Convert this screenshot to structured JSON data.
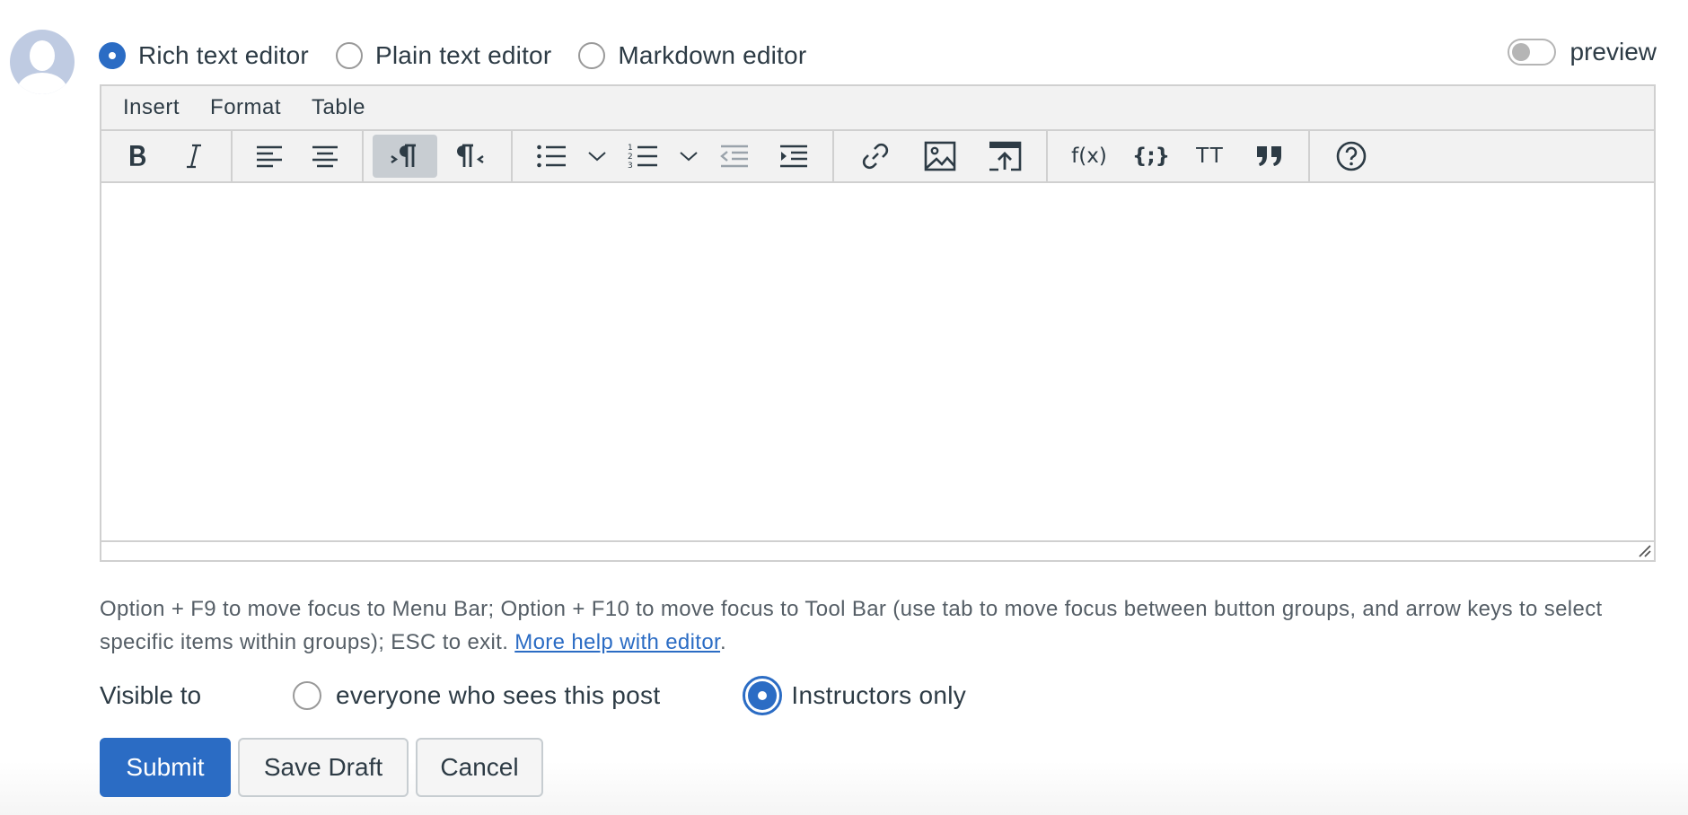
{
  "editor_modes": {
    "options": [
      {
        "label": "Rich text editor",
        "selected": true
      },
      {
        "label": "Plain text editor",
        "selected": false
      },
      {
        "label": "Markdown editor",
        "selected": false
      }
    ]
  },
  "preview": {
    "label": "preview",
    "enabled": false
  },
  "menubar": {
    "items": [
      "Insert",
      "Format",
      "Table"
    ]
  },
  "toolbar": {
    "function_label": "f(x)",
    "code_label": "{;}",
    "monospace_label": "TT",
    "icons": [
      "bold-icon",
      "italic-icon",
      "align-left-icon",
      "align-center-icon",
      "ltr-icon",
      "rtl-icon",
      "bullet-list-icon",
      "numbered-list-icon",
      "outdent-icon",
      "indent-icon",
      "link-icon",
      "image-icon",
      "upload-icon",
      "function-icon",
      "code-icon",
      "monospace-icon",
      "quote-icon",
      "help-icon"
    ]
  },
  "help": {
    "text": "Option + F9 to move focus to Menu Bar; Option + F10 to move focus to Tool Bar (use tab to move focus between button groups, and arrow keys to select specific items within groups); ESC to exit. ",
    "link": "More help with editor",
    "suffix": "."
  },
  "visibility": {
    "label": "Visible to",
    "options": [
      {
        "label": "everyone who sees this post",
        "selected": false
      },
      {
        "label": "Instructors only",
        "selected": true
      }
    ]
  },
  "actions": {
    "submit": "Submit",
    "save_draft": "Save Draft",
    "cancel": "Cancel"
  },
  "colors": {
    "accent": "#2b6cc4",
    "text": "#2d3b45",
    "toolbar_bg": "#f2f2f2",
    "border": "#d0d0d0"
  }
}
